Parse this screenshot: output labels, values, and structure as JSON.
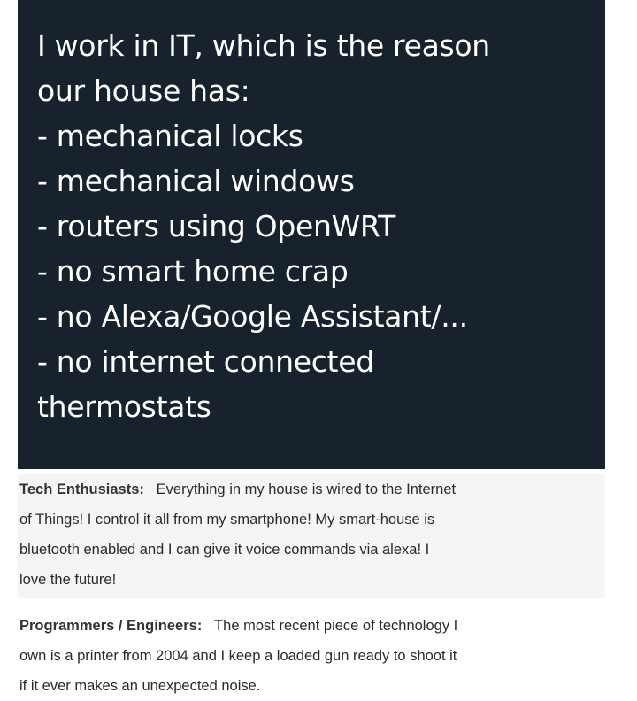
{
  "post": {
    "lines": [
      "I work in IT, which is the reason",
      "our house has:",
      "- mechanical locks",
      "- mechanical windows",
      "- routers using OpenWRT",
      "- no smart home crap",
      "- no Alexa/Google Assistant/...",
      "- no internet connected",
      "thermostats"
    ]
  },
  "tech": {
    "label": "Tech Enthusiasts:",
    "lines": [
      "Everything in my house is wired to the Internet",
      "of Things! I control it all from my smartphone! My smart-house is",
      "bluetooth enabled and I can give it voice commands via alexa! I",
      "love the future!"
    ]
  },
  "programmers": {
    "label": "Programmers / Engineers:",
    "lines": [
      "The most recent piece of technology I",
      "own is a printer from 2004 and I keep a loaded gun ready to shoot it",
      "if it ever makes an unexpected noise."
    ]
  }
}
